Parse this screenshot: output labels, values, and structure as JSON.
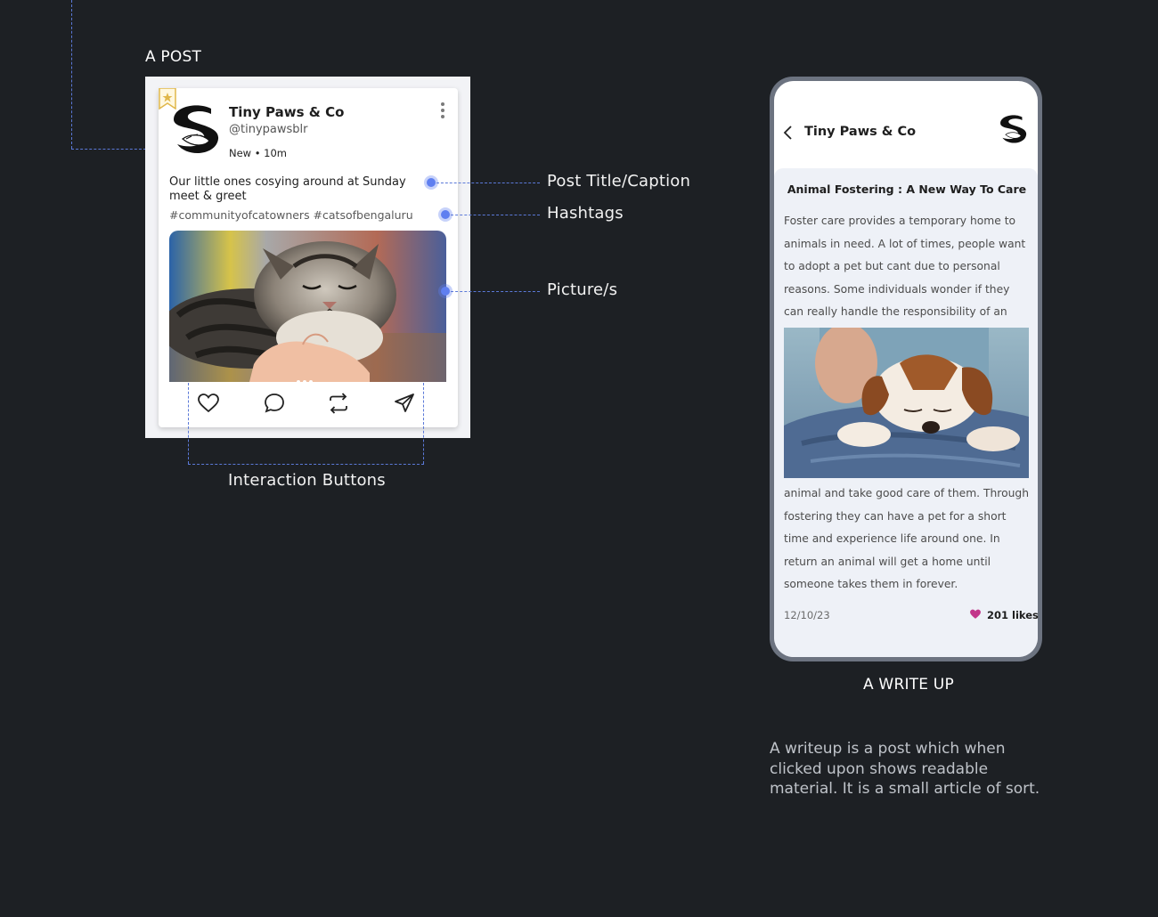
{
  "post_section": {
    "label": "A POST",
    "card": {
      "name": "Tiny Paws & Co",
      "handle": "@tinypawsblr",
      "time": "New • 10m",
      "caption": "Our little ones cosying around at Sunday meet & greet",
      "hashtags": "#communityofcatowners #catsofbengaluru",
      "image_icon": "cat-photo",
      "actions": [
        "heart-icon",
        "comment-icon",
        "repost-icon",
        "share-icon"
      ]
    },
    "annotations": {
      "caption": "Post Title/Caption",
      "hashtags": "Hashtags",
      "pictures": "Picture/s",
      "interaction": "Interaction Buttons"
    }
  },
  "writeup_section": {
    "label": "A WRITE UP",
    "header": {
      "title": "Tiny Paws & Co"
    },
    "article": {
      "title": "Animal Fostering : A New Way To Care",
      "paragraph_top": "Foster care provides a temporary home to animals in need. A lot of times, people want to adopt a pet but cant due to personal reasons. Some individuals wonder if they can really handle the responsibility of an",
      "paragraph_bottom": "animal and take good care of them. Through fostering they can have a pet for a short time and experience life around one. In return an animal will get a home until someone takes them in forever.",
      "date": "12/10/23",
      "likes": "201 likes"
    },
    "description": "A writeup is a post which when clicked upon shows readable material. It is a small article of sort."
  },
  "colors": {
    "background": "#1d2024",
    "accent": "#5f7ff0",
    "like_heart": "#c2358a"
  }
}
